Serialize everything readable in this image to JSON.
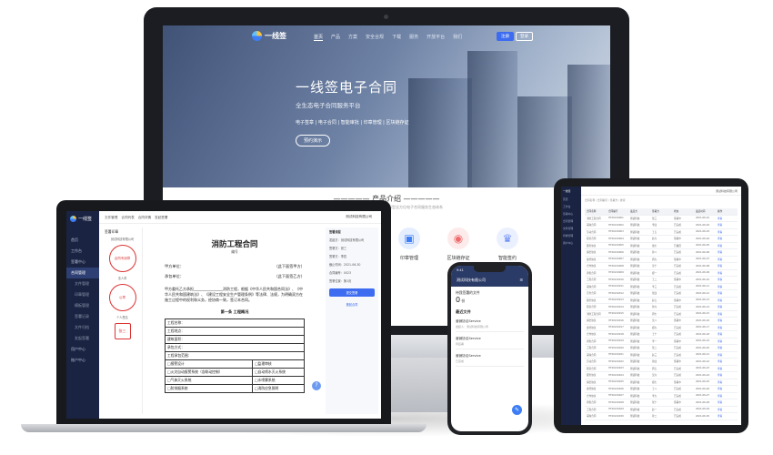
{
  "site": {
    "logo_text": "一线签",
    "nav": [
      "首页",
      "产品",
      "方案",
      "安全合规",
      "下载",
      "服务",
      "开放平台",
      "我们"
    ],
    "register": "注册",
    "login": "登录",
    "hero_title": "一线签电子合同",
    "hero_subtitle": "全生态电子合同服务平台",
    "hero_tags": "电子签章 | 电子合同 | 智能审批 | 印章管理 | 区块链存证",
    "hero_button": "预约演示",
    "product_title": "产品介绍",
    "product_subtitle": "整合产业链上下游，双向赋能，打造新型全方位电子合同服务生态体系",
    "features": [
      {
        "label": "印章管理",
        "icon": "seal-management-icon",
        "color": "#3d7df5"
      },
      {
        "label": "区块链存证",
        "icon": "blockchain-icon",
        "color": "#f06a6a"
      },
      {
        "label": "智能签约",
        "icon": "crown-icon",
        "color": "#6c8cf5"
      }
    ]
  },
  "laptop": {
    "app_name": "一线签",
    "menu": [
      "首页",
      "工作台",
      "签署中心",
      "合同管理",
      "文件管理",
      "印章管理",
      "模板管理",
      "签署记录",
      "文件归档",
      "发起签署",
      "用户中心",
      "账户中心"
    ],
    "breadcrumb": [
      "文件管理",
      "合同列表",
      "合同详情",
      "发起签署"
    ],
    "user": "测试科技有限公司",
    "left_title": "签署印章",
    "seal_labels": [
      "测试科技有限公司",
      "法人章",
      "个人签名"
    ],
    "seal_texts": [
      "合同专用章",
      "公章",
      "张三"
    ],
    "doc_title": "消防工程合同",
    "doc_no": "编号",
    "party_a_label": "甲方单位：",
    "party_a_value": "（此下面签甲方）",
    "party_b_label": "承包单位：",
    "party_b_value": "（此下面签乙方）",
    "paragraph": "甲方委托乙方承担________________消防工程，根据《中华人民共和国合同法》、《中华人民共和国建筑法》、《建设工程安全生产管理条例》等法律、法规，为明确双方在施工过程中的权利和义务，经协商一致，签订本合同。",
    "chapter": "第一条 工程概况",
    "table_rows": [
      "工程名称：",
      "工程地点：",
      "建筑面积：",
      "承包方式：",
      "工程承包范围：",
      "□报警设计",
      "□火灾自动报警系统（含联动控制）",
      "□气体灭火系统",
      "□防排烟系统"
    ],
    "table_rows_right": [
      "□监理审核",
      "□自动喷水灭火系统",
      "□水喷雾系统",
      "□消防应急照明"
    ],
    "right_title": "签署流程",
    "right_items": [
      "发起方：测试科技有限公司",
      "签署方：张三",
      "签署方：李四",
      "截止时间：2021-06-30",
      "合同编号：0023",
      "签署位置：第1页"
    ],
    "right_button": "提交签署",
    "right_link": "撤回合同"
  },
  "phone": {
    "time": "9:41",
    "company": "测试科技有限公司",
    "card_label": "待我签署的文件",
    "card_value": "0",
    "card_unit": "份",
    "section": "最近文件",
    "items": [
      {
        "name": "营销协议Service",
        "meta": "发起人：测试科技有限公司"
      },
      {
        "name": "营销协议Service",
        "meta": "待签署"
      },
      {
        "name": "营销协议Service",
        "meta": "已完成"
      }
    ]
  },
  "tablet": {
    "app_name": "一线签",
    "user": "测试科技有限公司",
    "menu": [
      "首页",
      "工作台",
      "签署中心",
      "合同管理",
      "文件管理",
      "印章管理",
      "用户中心"
    ],
    "filter": "合同名称 / 合同编号 / 签署方 / 搜索",
    "headers": [
      "合同名称",
      "合同编号",
      "发起方",
      "签署方",
      "状态",
      "发起时间",
      "操作"
    ],
    "rows": [
      [
        "消防工程合同",
        "HT20210001",
        "测试科技",
        "张三",
        "签署中",
        "2021-06-01",
        "查看"
      ],
      [
        "采购合同",
        "HT20210002",
        "测试科技",
        "李四",
        "已完成",
        "2021-06-02",
        "查看"
      ],
      [
        "劳动合同",
        "HT20210003",
        "测试科技",
        "王五",
        "已完成",
        "2021-06-03",
        "查看"
      ],
      [
        "租赁合同",
        "HT20210004",
        "测试科技",
        "赵六",
        "签署中",
        "2021-06-04",
        "查看"
      ],
      [
        "服务协议",
        "HT20210005",
        "测试科技",
        "钱七",
        "已撤回",
        "2021-06-05",
        "查看"
      ],
      [
        "保密协议",
        "HT20210006",
        "测试科技",
        "孙八",
        "已完成",
        "2021-06-06",
        "查看"
      ],
      [
        "委托协议",
        "HT20210007",
        "测试科技",
        "周九",
        "签署中",
        "2021-06-07",
        "查看"
      ],
      [
        "合作协议",
        "HT20210008",
        "测试科技",
        "吴十",
        "已完成",
        "2021-06-08",
        "查看"
      ],
      [
        "销售合同",
        "HT20210009",
        "测试科技",
        "郑一",
        "已完成",
        "2021-06-09",
        "查看"
      ],
      [
        "工程合同",
        "HT20210010",
        "测试科技",
        "王二",
        "签署中",
        "2021-06-10",
        "查看"
      ],
      [
        "采购合同",
        "HT20210011",
        "测试科技",
        "李三",
        "已完成",
        "2021-06-11",
        "查看"
      ],
      [
        "劳务合同",
        "HT20210012",
        "测试科技",
        "张四",
        "已完成",
        "2021-06-12",
        "查看"
      ],
      [
        "服务协议",
        "HT20210013",
        "测试科技",
        "赵五",
        "签署中",
        "2021-06-13",
        "查看"
      ],
      [
        "租赁合同",
        "HT20210014",
        "测试科技",
        "孙六",
        "已完成",
        "2021-06-14",
        "查看"
      ],
      [
        "消防工程合同",
        "HT20210015",
        "测试科技",
        "周七",
        "已完成",
        "2021-06-15",
        "查看"
      ],
      [
        "保密协议",
        "HT20210016",
        "测试科技",
        "吴八",
        "签署中",
        "2021-06-16",
        "查看"
      ],
      [
        "委托协议",
        "HT20210017",
        "测试科技",
        "郑九",
        "已完成",
        "2021-06-17",
        "查看"
      ],
      [
        "合作协议",
        "HT20210018",
        "测试科技",
        "王十",
        "已完成",
        "2021-06-18",
        "查看"
      ],
      [
        "销售合同",
        "HT20210019",
        "测试科技",
        "李一",
        "签署中",
        "2021-06-19",
        "查看"
      ],
      [
        "工程合同",
        "HT20210020",
        "测试科技",
        "张二",
        "已完成",
        "2021-06-20",
        "查看"
      ],
      [
        "采购合同",
        "HT20210021",
        "测试科技",
        "赵三",
        "已完成",
        "2021-06-21",
        "查看"
      ],
      [
        "劳动合同",
        "HT20210022",
        "测试科技",
        "孙四",
        "签署中",
        "2021-06-22",
        "查看"
      ],
      [
        "租赁合同",
        "HT20210023",
        "测试科技",
        "周五",
        "已完成",
        "2021-06-23",
        "查看"
      ],
      [
        "服务协议",
        "HT20210024",
        "测试科技",
        "吴六",
        "已完成",
        "2021-06-24",
        "查看"
      ],
      [
        "保密协议",
        "HT20210025",
        "测试科技",
        "郑七",
        "签署中",
        "2021-06-25",
        "查看"
      ],
      [
        "委托协议",
        "HT20210026",
        "测试科技",
        "王八",
        "已完成",
        "2021-06-26",
        "查看"
      ],
      [
        "合作协议",
        "HT20210027",
        "测试科技",
        "李九",
        "已完成",
        "2021-06-27",
        "查看"
      ],
      [
        "销售合同",
        "HT20210028",
        "测试科技",
        "张十",
        "签署中",
        "2021-06-28",
        "查看"
      ],
      [
        "工程合同",
        "HT20210029",
        "测试科技",
        "赵一",
        "已完成",
        "2021-06-29",
        "查看"
      ],
      [
        "采购合同",
        "HT20210030",
        "测试科技",
        "孙二",
        "已完成",
        "2021-06-30",
        "查看"
      ]
    ]
  }
}
